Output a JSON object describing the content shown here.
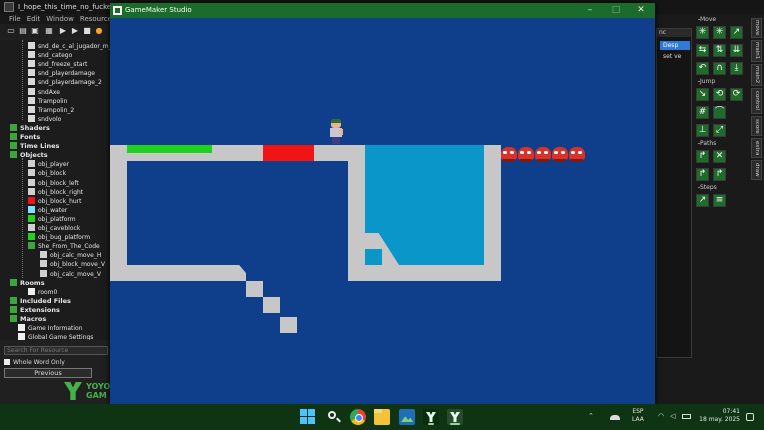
{
  "ide": {
    "title": "I_hope_this_time_no_fucked_ga",
    "menu": [
      "File",
      "Edit",
      "Window",
      "Resources",
      "S"
    ],
    "tree": [
      {
        "label": "snd_de_c_al_jugador_m_p",
        "icon": "sound-icon"
      },
      {
        "label": "snd_catego",
        "icon": "sound-icon"
      },
      {
        "label": "snd_freeze_start",
        "icon": "sound-icon"
      },
      {
        "label": "snd_playerdamage",
        "icon": "sound-icon"
      },
      {
        "label": "snd_playerdamage_2",
        "icon": "sound-icon"
      },
      {
        "label": "sndAxe",
        "icon": "sound-icon"
      },
      {
        "label": "Trampolin",
        "icon": "sound-icon"
      },
      {
        "label": "Trampolin_2",
        "icon": "sound-icon"
      },
      {
        "label": "sndvolo",
        "icon": "sound-icon"
      },
      {
        "label": "Shaders",
        "icon": "folder-icon",
        "folder": true
      },
      {
        "label": "Fonts",
        "icon": "folder-icon",
        "folder": true
      },
      {
        "label": "Time Lines",
        "icon": "folder-icon",
        "folder": true
      },
      {
        "label": "Objects",
        "icon": "folder-icon",
        "folder": true
      },
      {
        "label": "obj_player",
        "icon": "object-icon"
      },
      {
        "label": "obj_block",
        "icon": "object-icon"
      },
      {
        "label": "obj_block_left",
        "icon": "object-icon"
      },
      {
        "label": "obj_block_right",
        "icon": "object-icon"
      },
      {
        "label": "obj_block_hurt",
        "icon": "object-icon"
      },
      {
        "label": "obj_water",
        "icon": "object-icon"
      },
      {
        "label": "obj_platform",
        "icon": "object-icon"
      },
      {
        "label": "obj_caveblock",
        "icon": "object-icon"
      },
      {
        "label": "obj_bug_platform",
        "icon": "object-icon"
      },
      {
        "label": "She_From_The_Code",
        "icon": "folder-icon"
      },
      {
        "label": "obj_calc_move_H",
        "icon": "object-icon"
      },
      {
        "label": "obj_block_move_V",
        "icon": "object-icon"
      },
      {
        "label": "obj_calc_move_V",
        "icon": "object-icon"
      },
      {
        "label": "Rooms",
        "icon": "folder-icon",
        "folder": true
      },
      {
        "label": "room0",
        "icon": "room-icon"
      },
      {
        "label": "Included Files",
        "icon": "folder-icon",
        "folder": true
      },
      {
        "label": "Extensions",
        "icon": "folder-icon",
        "folder": true
      },
      {
        "label": "Macros",
        "icon": "folder-icon",
        "folder": true
      },
      {
        "label": "Game Information",
        "icon": "document-icon"
      },
      {
        "label": "Global Game Settings",
        "icon": "document-icon"
      }
    ],
    "search_placeholder": "Search For Resource",
    "whole_word_label": "Whole Word Only",
    "previous_label": "Previous",
    "logo_top": "YOYO",
    "logo_bottom": "GAM"
  },
  "right_panel": {
    "list_header": "nc",
    "list_items": [
      "Desp",
      "set ve"
    ],
    "sections": [
      "Move",
      "Jump",
      "Paths",
      "Steps"
    ],
    "tabs": [
      "move",
      "main1",
      "main2",
      "control",
      "score",
      "extra",
      "draw"
    ]
  },
  "game_window": {
    "title": "GameMaker Studio",
    "minimize_glyph": "–",
    "maximize_glyph": "□",
    "close_glyph": "✕",
    "background_color": "#0f3f8a",
    "water_color": "#0a96c8",
    "green_color": "#1fd21f",
    "red_color": "#f01414"
  },
  "taskbar": {
    "lang_top": "ESP",
    "lang_bottom": "LAA",
    "time": "07:41",
    "date": "18 may. 2025"
  }
}
